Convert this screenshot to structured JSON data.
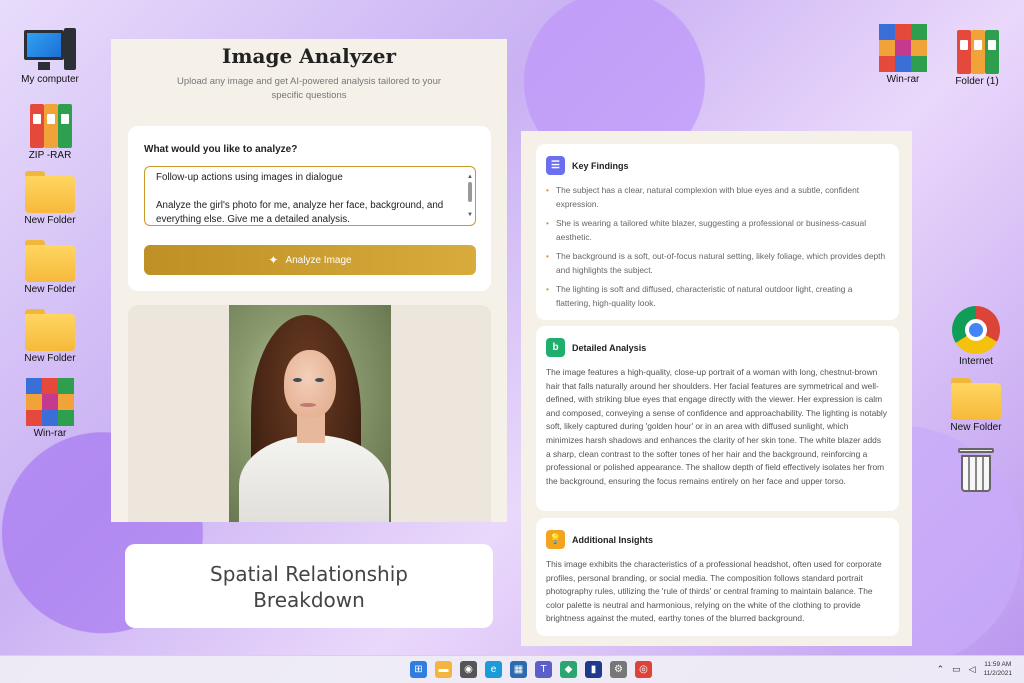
{
  "desktop": {
    "left_icons": [
      "My computer",
      "ZIP -RAR",
      "New Folder",
      "New Folder",
      "New Folder",
      "Win-rar"
    ],
    "right_top_icons": [
      "Win-rar",
      "Folder (1)"
    ],
    "right_icons": [
      "Internet",
      "New Folder"
    ]
  },
  "analyzer": {
    "title": "Image Analyzer",
    "subtitle": "Upload any image and get AI-powered analysis tailored to your specific questions",
    "question_label": "What would you like to analyze?",
    "prompt_line1": "Follow-up actions using images in dialogue",
    "prompt_line2": "Analyze the girl's photo for me, analyze her face, background, and everything else. Give me a detailed analysis.",
    "analyze_button": "Analyze Image",
    "accent_color": "#c99a28"
  },
  "caption": {
    "line1": "Spatial Relationship",
    "line2": "Breakdown"
  },
  "results": {
    "key_findings": {
      "title": "Key Findings",
      "items": [
        "The subject has a clear, natural complexion with blue eyes and a subtle, confident expression.",
        "She is wearing a tailored white blazer, suggesting a professional or business-casual aesthetic.",
        "The background is a soft, out-of-focus natural setting, likely foliage, which provides depth and highlights the subject.",
        "The lighting is soft and diffused, characteristic of natural outdoor light, creating a flattering, high-quality look."
      ]
    },
    "detailed_analysis": {
      "title": "Detailed Analysis",
      "text": "The image features a high-quality, close-up portrait of a woman with long, chestnut-brown hair that falls naturally around her shoulders. Her facial features are symmetrical and well-defined, with striking blue eyes that engage directly with the viewer. Her expression is calm and composed, conveying a sense of confidence and approachability. The lighting is notably soft, likely captured during 'golden hour' or in an area with diffused sunlight, which minimizes harsh shadows and enhances the clarity of her skin tone. The white blazer adds a sharp, clean contrast to the softer tones of her hair and the background, reinforcing a professional or polished appearance. The shallow depth of field effectively isolates her from the background, ensuring the focus remains entirely on her face and upper torso."
    },
    "additional_insights": {
      "title": "Additional Insights",
      "text": "This image exhibits the characteristics of a professional headshot, often used for corporate profiles, personal branding, or social media. The composition follows standard portrait photography rules, utilizing the 'rule of thirds' or central framing to maintain balance. The color palette is neutral and harmonious, relying on the white of the clothing to provide brightness against the muted, earthy tones of the blurred background."
    }
  },
  "taskbar": {
    "time": "11:59 AM",
    "date": "11/2/2021"
  }
}
